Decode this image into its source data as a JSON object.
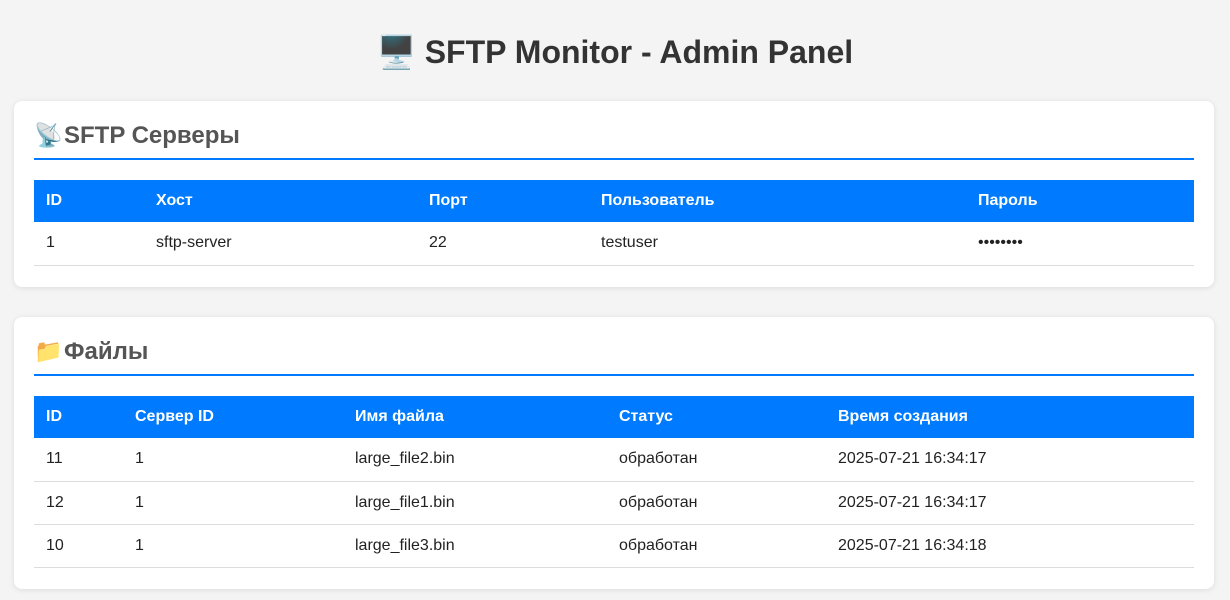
{
  "page": {
    "title": "SFTP Monitor - Admin Panel",
    "title_icon": "🖥️"
  },
  "servers": {
    "heading": "SFTP Серверы",
    "heading_icon": "📡",
    "columns": [
      "ID",
      "Хост",
      "Порт",
      "Пользователь",
      "Пароль"
    ],
    "rows": [
      [
        "1",
        "sftp-server",
        "22",
        "testuser",
        "••••••••"
      ]
    ]
  },
  "files": {
    "heading": "Файлы",
    "heading_icon": "📁",
    "columns": [
      "ID",
      "Сервер ID",
      "Имя файла",
      "Статус",
      "Время создания"
    ],
    "rows": [
      [
        "11",
        "1",
        "large_file2.bin",
        "обработан",
        "2025-07-21 16:34:17"
      ],
      [
        "12",
        "1",
        "large_file1.bin",
        "обработан",
        "2025-07-21 16:34:17"
      ],
      [
        "10",
        "1",
        "large_file3.bin",
        "обработан",
        "2025-07-21 16:34:18"
      ]
    ]
  },
  "colors": {
    "accent": "#007bff",
    "background": "#f4f4f4"
  }
}
